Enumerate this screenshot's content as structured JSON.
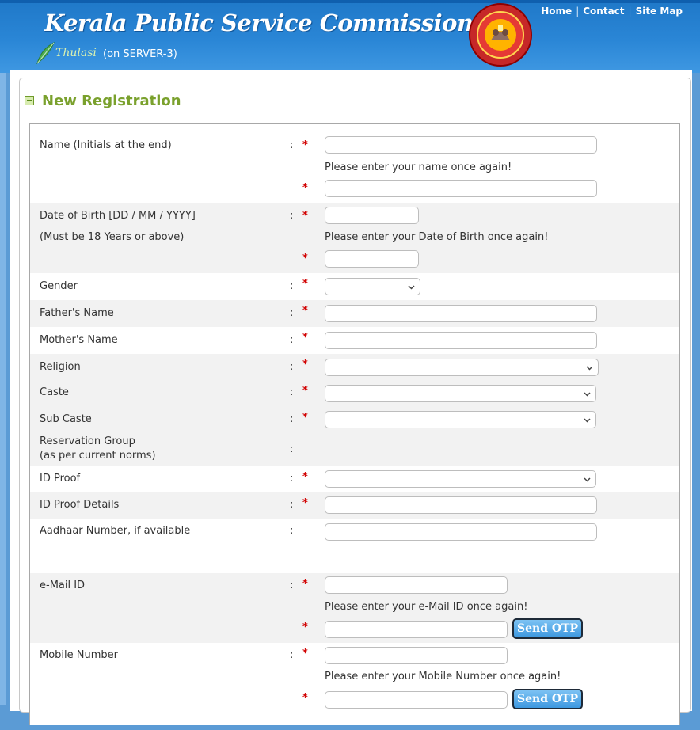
{
  "header": {
    "title": "Kerala Public Service Commission",
    "brand": "Thulasi",
    "server": "(on SERVER-3)",
    "nav": [
      {
        "label": "Home"
      },
      {
        "label": "Contact"
      },
      {
        "label": "Site Map"
      }
    ],
    "nav_separator": "|"
  },
  "section": {
    "title": "New Registration"
  },
  "form": {
    "colon": ":",
    "required_mark": "*",
    "name": {
      "label": "Name (Initials at the end)",
      "confirm_hint": "Please enter your name once again!"
    },
    "dob": {
      "label": "Date of Birth [DD / MM / YYYY]",
      "note": "(Must be 18 Years or above)",
      "confirm_hint": "Please enter your Date of Birth once again!"
    },
    "gender": {
      "label": "Gender"
    },
    "father": {
      "label": "Father's Name"
    },
    "mother": {
      "label": "Mother's Name"
    },
    "religion": {
      "label": "Religion"
    },
    "caste": {
      "label": "Caste"
    },
    "subcaste": {
      "label": "Sub Caste"
    },
    "reservation": {
      "label_line1": "Reservation Group",
      "label_line2": "(as per current norms)"
    },
    "idproof": {
      "label": "ID Proof"
    },
    "idproof_details": {
      "label": "ID Proof Details"
    },
    "aadhaar": {
      "label": "Aadhaar Number, if available"
    },
    "email": {
      "label": "e-Mail ID",
      "confirm_hint": "Please enter your e-Mail ID once again!",
      "otp_button": "Send OTP"
    },
    "mobile": {
      "label": "Mobile Number",
      "confirm_hint": "Please enter your Mobile Number once again!",
      "otp_button": "Send OTP"
    }
  },
  "colors": {
    "header_blue": "#2a86d6",
    "title_green": "#7aa12d",
    "required_red": "#d10000",
    "button_blue": "#3d98e0"
  }
}
